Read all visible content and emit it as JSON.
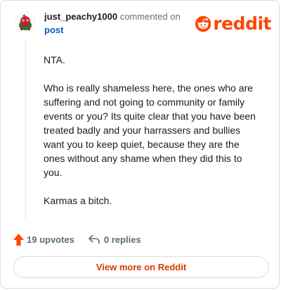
{
  "comment": {
    "username": "just_peachy1000",
    "action_text": "commented on",
    "post_link": "post",
    "paragraphs": [
      "NTA.",
      "Who is really shameless here, the ones who are suffering and not going to community or family events or you? Its quite clear that you have been treated badly and your harrassers and bullies want you to keep quiet, because they are the ones without any shame when they did this to you.",
      "Karmas a bitch."
    ]
  },
  "brand": {
    "name": "reddit",
    "color": "#ff4500"
  },
  "actions": {
    "upvotes": "19 upvotes",
    "replies": "0 replies"
  },
  "footer": {
    "view_more": "View more on Reddit"
  },
  "colors": {
    "link": "#0a5bb8",
    "view_more": "#d93a00",
    "upvote_arrow": "#ff4500",
    "meta": "#576f76"
  }
}
